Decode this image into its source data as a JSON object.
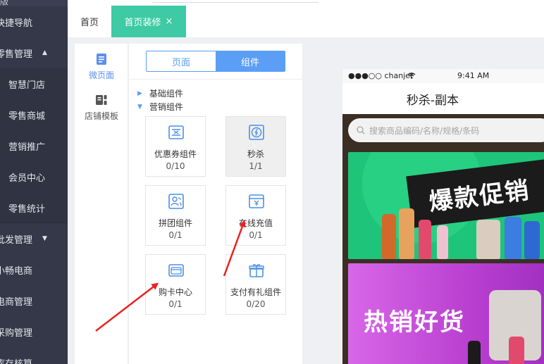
{
  "sidebar": {
    "top_partial": "版",
    "items": [
      {
        "label": "快捷导航",
        "kind": "group"
      },
      {
        "label": "零售管理",
        "kind": "group",
        "caret": "▲"
      },
      {
        "label": "智慧门店",
        "kind": "sub"
      },
      {
        "label": "零售商城",
        "kind": "sub"
      },
      {
        "label": "营销推广",
        "kind": "sub"
      },
      {
        "label": "会员中心",
        "kind": "sub"
      },
      {
        "label": "零售统计",
        "kind": "sub"
      },
      {
        "label": "批发管理",
        "kind": "group",
        "caret": "▼"
      },
      {
        "label": "小畅电商",
        "kind": "group"
      },
      {
        "label": "电商管理",
        "kind": "group"
      },
      {
        "label": "采购管理",
        "kind": "group"
      },
      {
        "label": "库存核算",
        "kind": "group"
      }
    ]
  },
  "tabs": {
    "home": "首页",
    "active": "首页装修",
    "close": "×"
  },
  "left_column": {
    "micro_page": "微页面",
    "store_template": "店铺模板"
  },
  "panel": {
    "segment_page": "页面",
    "segment_component": "组件",
    "category_basic": "基础组件",
    "category_marketing": "营销组件",
    "components": [
      {
        "name": "优惠券组件",
        "count": "0/10",
        "icon": "coupon-icon"
      },
      {
        "name": "秒杀",
        "count": "1/1",
        "icon": "flash-sale-icon"
      },
      {
        "name": "拼团组件",
        "count": "0/1",
        "icon": "group-buy-icon"
      },
      {
        "name": "在线充值",
        "count": "0/1",
        "icon": "recharge-icon"
      },
      {
        "name": "购卡中心",
        "count": "0/1",
        "icon": "card-center-icon"
      },
      {
        "name": "支付有礼组件",
        "count": "0/20",
        "icon": "gift-icon"
      }
    ]
  },
  "phone": {
    "carrier": "●●●○○ chanjet",
    "time": "9:41 AM",
    "title": "秒杀-副本",
    "search_placeholder": "搜索商品编码/名称/规格/条码",
    "banner1_text": "爆款促销",
    "banner2_text": "热销好货"
  },
  "colors": {
    "sidebar_bg": "#3a3f51",
    "tab_active": "#3dcaa4",
    "accent_blue": "#5b9ef5",
    "arrow_red": "#e8231f"
  }
}
